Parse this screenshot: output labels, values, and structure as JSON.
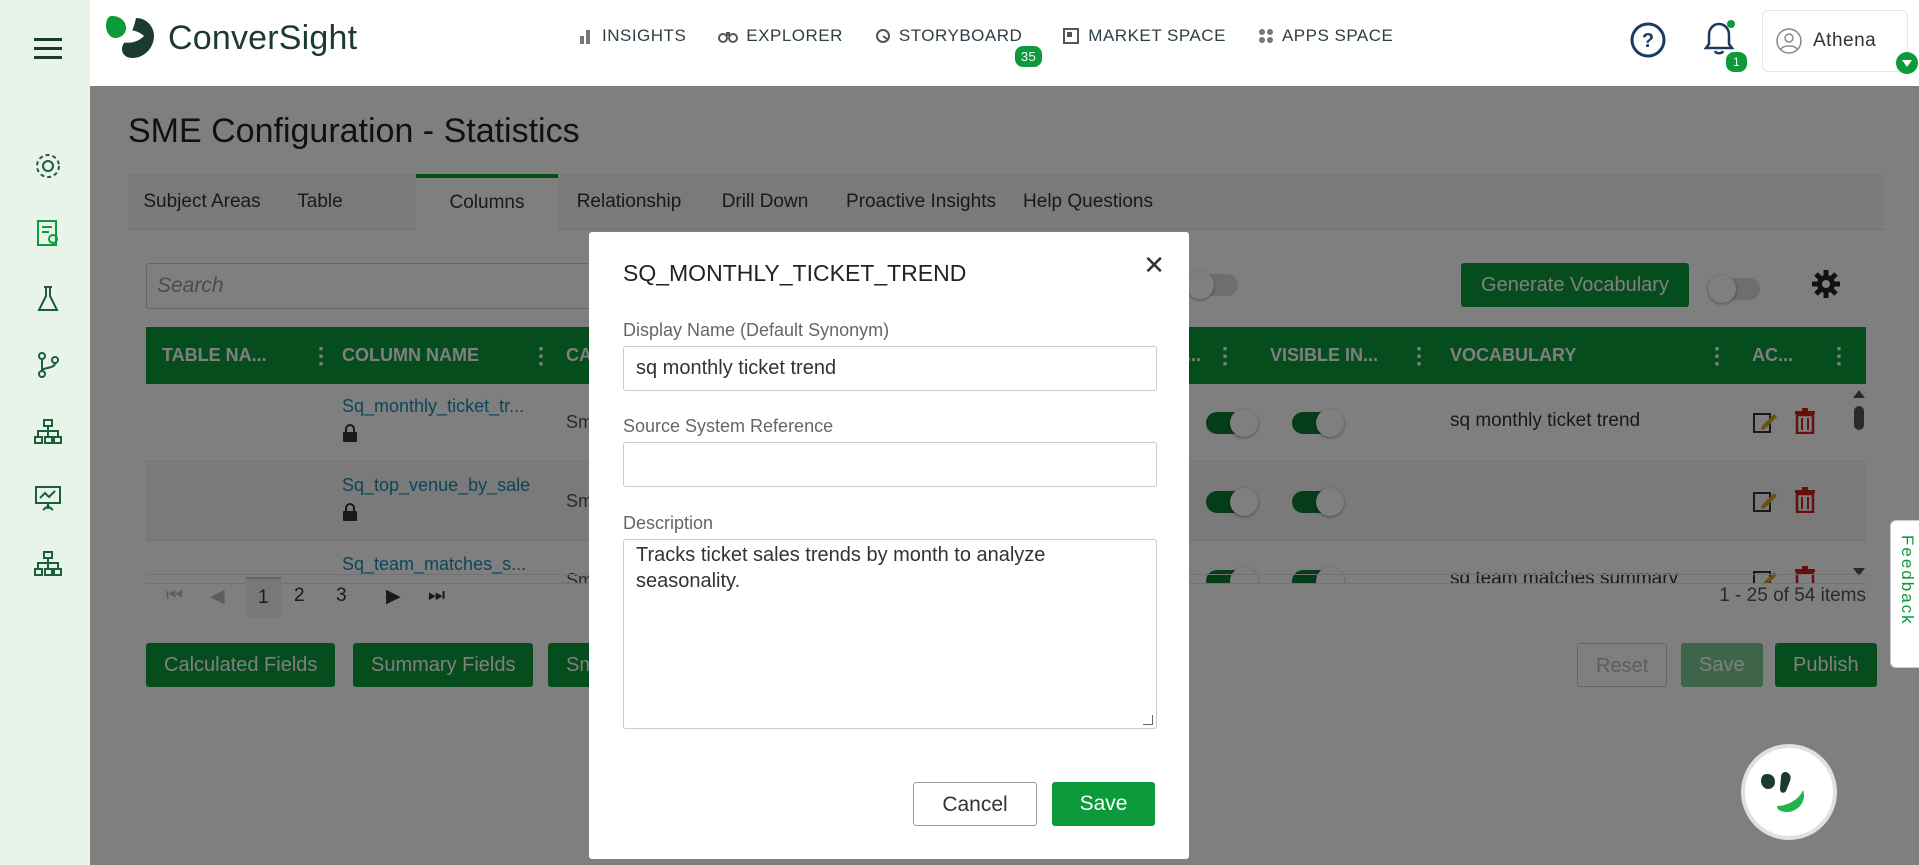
{
  "app": {
    "name": "ConverSight"
  },
  "nav": {
    "insights": "INSIGHTS",
    "explorer": "EXPLORER",
    "storyboard": "STORYBOARD",
    "storyboard_badge": "35",
    "market_space": "MARKET SPACE",
    "apps_space": "APPS SPACE"
  },
  "header": {
    "notif_count": "1",
    "user_name": "Athena"
  },
  "page": {
    "title": "SME Configuration - Statistics"
  },
  "tabs": [
    "Subject Areas",
    "Table",
    "Columns",
    "Relationship",
    "Drill Down",
    "Proactive Insights",
    "Help Questions"
  ],
  "toolbar": {
    "search_placeholder": "Search",
    "generate_vocabulary": "Generate Vocabulary"
  },
  "grid": {
    "columns": [
      "TABLE NA...",
      "COLUMN NAME",
      "CA",
      "...",
      "VISIBLE IN...",
      "VOCABULARY",
      "AC..."
    ],
    "rows": [
      {
        "column_name": "Sq_monthly_ticket_tr...",
        "ca": "Sm",
        "vocabulary": "sq monthly ticket trend"
      },
      {
        "column_name": "Sq_top_venue_by_sale",
        "ca": "Sm",
        "vocabulary": ""
      },
      {
        "column_name": "Sq_team_matches_s...",
        "ca": "Sm",
        "vocabulary": "sq team matches summary"
      }
    ]
  },
  "pager": {
    "pages": [
      "1",
      "2",
      "3"
    ],
    "items_text": "1 - 25 of 54 items"
  },
  "actions": {
    "calculated_fields": "Calculated Fields",
    "summary_fields": "Summary Fields",
    "third": "Sm",
    "reset": "Reset",
    "save": "Save",
    "publish": "Publish"
  },
  "feedback": "Feedback",
  "modal": {
    "title": "SQ_MONTHLY_TICKET_TREND",
    "display_name_label": "Display Name (Default Synonym)",
    "display_name_value": "sq monthly ticket trend",
    "source_label": "Source System Reference",
    "source_value": "",
    "description_label": "Description",
    "description_value": "Tracks ticket sales trends by month to analyze seasonality.",
    "cancel": "Cancel",
    "save": "Save"
  },
  "colors": {
    "brand_green": "#0c9a3a",
    "link": "#1a8bb0",
    "delete": "#cc1f1f"
  }
}
